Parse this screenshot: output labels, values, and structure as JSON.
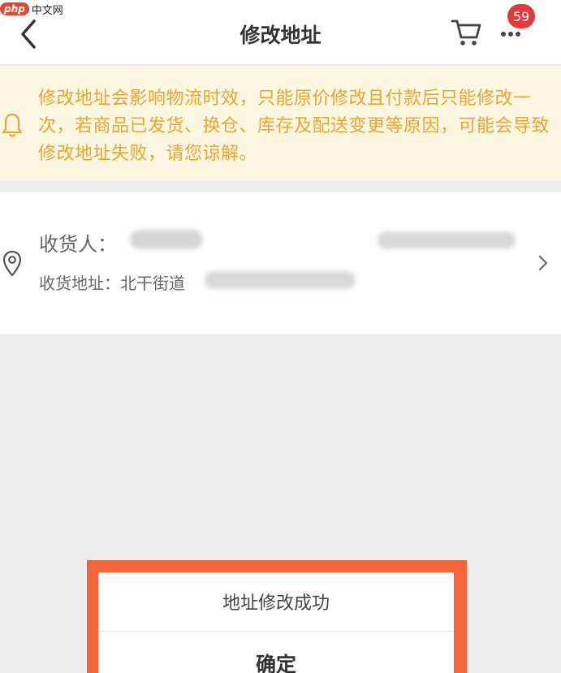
{
  "watermark": {
    "logo": "php",
    "text": "中文网"
  },
  "header": {
    "title": "修改地址",
    "back_icon": "chevron-left-icon",
    "cart_icon": "cart-icon",
    "more_icon": "more-dots-icon",
    "badge_count": "59"
  },
  "notice": {
    "icon": "bell-icon",
    "text": "修改地址会影响物流时效，只能原价修改且付款后只能修改一次，若商品已发货、换仓、库存及配送变更等原因，可能会导致修改地址失败，请您谅解。"
  },
  "address": {
    "icon": "location-pin-icon",
    "recipient_label": "收货人：",
    "address_label": "收货地址：北干街道",
    "chevron_icon": "chevron-right-icon"
  },
  "dialog": {
    "message": "地址修改成功",
    "confirm_label": "确定"
  },
  "colors": {
    "notice_bg": "#fdf7e1",
    "notice_text": "#e9a532",
    "badge": "#e33b3b",
    "highlight": "#f4633a"
  }
}
